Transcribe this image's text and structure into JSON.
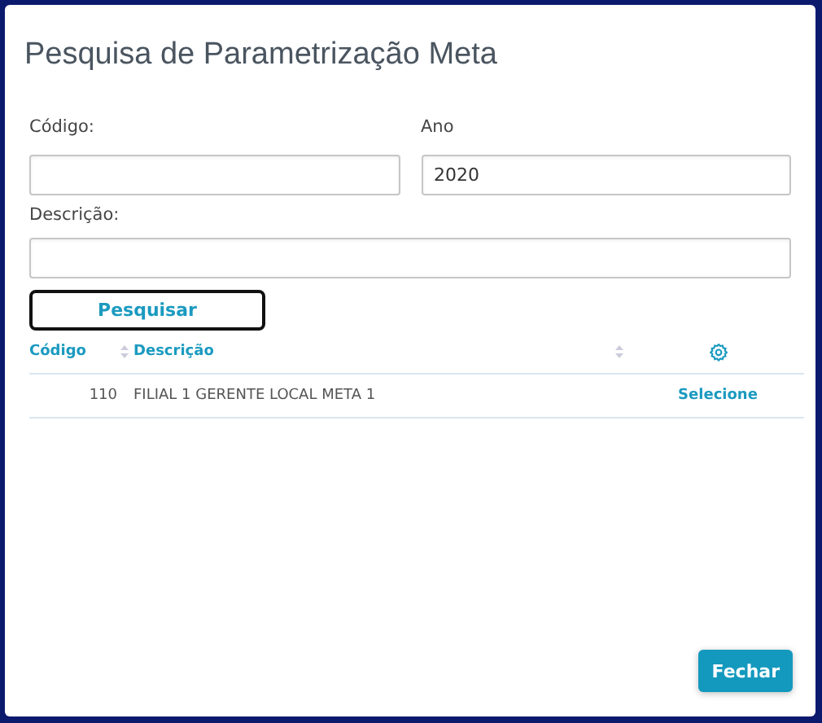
{
  "dialog": {
    "title": "Pesquisa de Parametrização Meta"
  },
  "fields": [
    {
      "label": "Código:"
    },
    {
      "label": "Ano",
      "value": "2020"
    },
    {
      "label": "Descrição:"
    }
  ],
  "search_button": "Pesquisar",
  "table": {
    "columns": [
      {
        "label": "Código"
      },
      {
        "label": "Descrição"
      }
    ],
    "rows": [
      {
        "code": "110",
        "description": "FILIAL 1 GERENTE LOCAL META 1",
        "action": "Selecione"
      }
    ]
  },
  "close_button": "Fechar"
}
